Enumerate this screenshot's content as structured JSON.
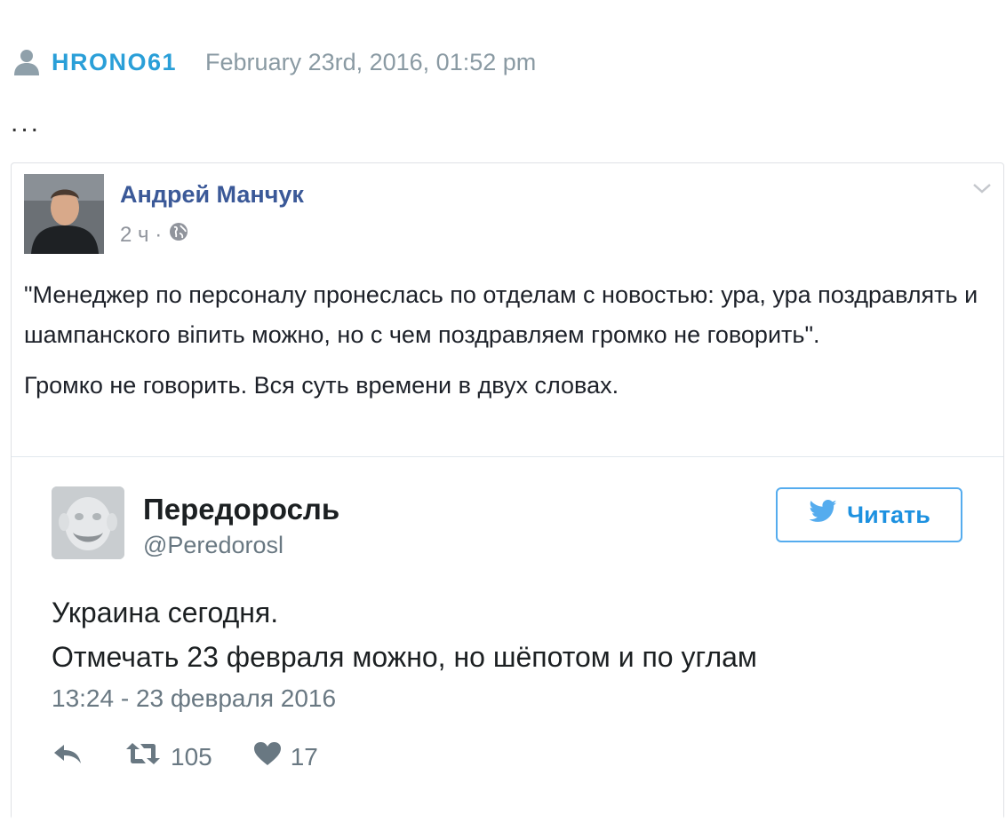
{
  "post": {
    "username": "HRONO61",
    "timestamp": "February 23rd, 2016, 01:52 pm",
    "ellipsis": "..."
  },
  "facebook": {
    "author": "Андрей Манчук",
    "time": "2 ч ·",
    "paragraph1": "\"Менеджер по персоналу пронеслась по отделам с новостью: ура, ура поздравлять и шампанского віпить можно, но с чем поздравляем громко не говорить\".",
    "paragraph2": "Громко не говорить. Вся суть времени в двух словах."
  },
  "tweet": {
    "name": "Передоросль",
    "handle": "@Peredorosl",
    "follow_label": "Читать",
    "line1": "Украина сегодня.",
    "line2": "Отмечать 23 февраля можно, но шёпотом и по углам",
    "date": "13:24 - 23 февраля 2016",
    "retweets": "105",
    "likes": "17"
  },
  "colors": {
    "username": "#2a9fd8",
    "fb_name": "#3b5998",
    "twitter_blue": "#55acee",
    "muted": "#697882"
  },
  "icons": [
    "user-icon",
    "globe-icon",
    "chevron-down-icon",
    "twitter-bird-icon",
    "reply-icon",
    "retweet-icon",
    "heart-icon"
  ]
}
